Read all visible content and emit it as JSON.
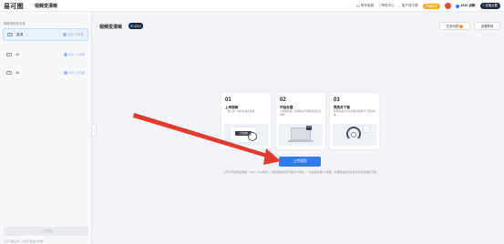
{
  "topbar": {
    "logo": "易可图",
    "page_title": "视频变清晰",
    "links": [
      {
        "icon": "headset-icon",
        "label": "联系客服"
      },
      {
        "icon": "help-icon",
        "label": "帮助中心"
      },
      {
        "icon": "download-icon",
        "label": "客户端下载"
      }
    ],
    "vip_label": "开通会员",
    "credits": "4210 点数",
    "recharge_label": "+ 充值点数"
  },
  "sidebar": {
    "heading": "视频清晰度选择",
    "items": [
      {
        "name": "高清",
        "price": "4点 / 1分钟",
        "icon_text": "HD",
        "active": true
      },
      {
        "name": "2K",
        "price": "6点 / 1分钟",
        "icon_text": "2K",
        "active": false
      },
      {
        "name": "4K",
        "price": "8点 / 1分钟",
        "icon_text": "4K",
        "active": false
      }
    ],
    "upload_button": "上传视频",
    "footnote": "大小不超过2G，时长不超过10分钟"
  },
  "main": {
    "title": "视频变清晰",
    "credit_chip": "4210",
    "history_button": "任务列表",
    "history_count": "0",
    "tutorial_button": "查看教程",
    "steps": [
      {
        "num": "01",
        "title": "上传视频",
        "desc": "一键上传，支持多格式视频",
        "illus_label": "上传视频"
      },
      {
        "num": "02",
        "title": "开始处理",
        "desc": "AI智能处理，时间取决于视频长度及分辨率",
        "illus_label": "50%"
      },
      {
        "num": "03",
        "title": "预览并下载",
        "desc": "处理完成后可在线预览效果并下载到本地",
        "illus_label": "↓"
      }
    ],
    "upload_button": "上传视频",
    "upload_tip": "上传不同清晰度视频（mp4、mov格式），每段视频时长不超过10分钟；一次最多处理1个视频，处理完成后可在任务列表查看和下载"
  }
}
